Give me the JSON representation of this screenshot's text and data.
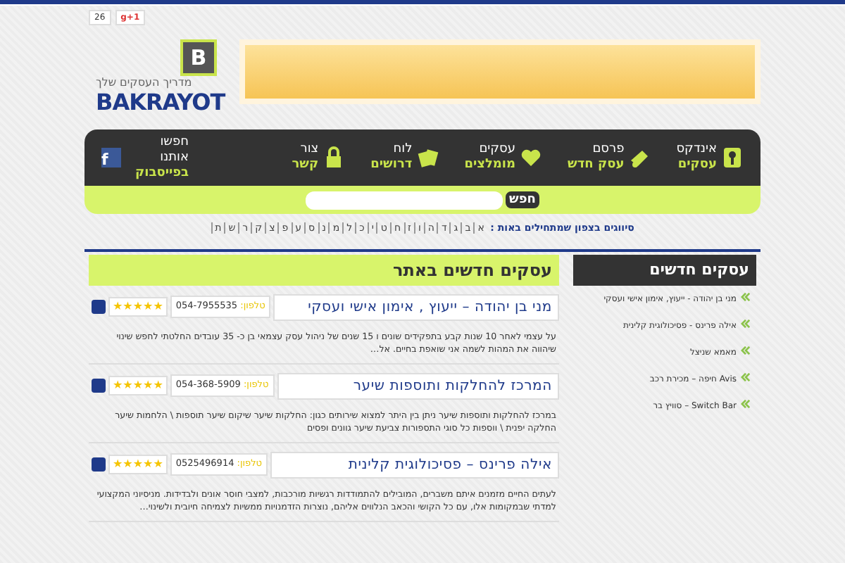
{
  "share": {
    "count": "26",
    "plus_one": "g+1"
  },
  "logo": {
    "tagline": "מדריך העסקים שלך",
    "name": "BAKRAYOT",
    "badge": "B"
  },
  "nav": [
    {
      "line1": "אינדקס",
      "line2": "עסקים"
    },
    {
      "line1": "פרסם",
      "line2": "עסק חדש"
    },
    {
      "line1": "עסקים",
      "line2": "מומלצים"
    },
    {
      "line1": "לוח",
      "line2": "דרושים"
    },
    {
      "line1": "צור",
      "line2": "קשר"
    }
  ],
  "facebook": {
    "line1": "חפשו",
    "line2": "אותנו",
    "line3": "בפייסבוק",
    "badge": "f"
  },
  "search": {
    "button": "חפש"
  },
  "letters": {
    "label": "סיווגים בצפון שמתחילים באות :",
    "items": [
      "א",
      "ב",
      "ג",
      "ד",
      "ה",
      "ו",
      "ז",
      "ח",
      "ט",
      "י",
      "כ",
      "ל",
      "מ",
      "נ",
      "ס",
      "ע",
      "פ",
      "צ",
      "ק",
      "ר",
      "ש",
      "ת"
    ]
  },
  "main": {
    "heading": "עסקים חדשים באתר",
    "items": [
      {
        "title": "מני בן יהודה – ייעוץ , אימון אישי ועסקי",
        "phone_label": "טלפון:",
        "phone": "054-7955535",
        "stars": 5,
        "text": "על עצמי לאחר 10 שנות קבע בתפקידים שונים ו 15 שנים של ניהול עסק עצמאי בן כ- 35 עובדים החלטתי לחפש שינוי שיהווה את המהות לשמה אני שואפת בחיים. אל…"
      },
      {
        "title": "המרכז להחלקות ותוספות שיער",
        "phone_label": "טלפון:",
        "phone": "054-368-5909",
        "stars": 5,
        "text": "במרכז להחלקות ותוספות שיער ניתן בין היתר למצוא שירותים כגון: החלקות שיער שיקום שיער תוספות \\ הלחמות שיער החלקה יפנית \\ ווספות כל סוגי התספורות צביעת שיער גוונים ופסים"
      },
      {
        "title": "אילה פרינס – פסיכולוגית קלינית",
        "phone_label": "טלפון:",
        "phone": "0525496914",
        "stars": 5,
        "text": "לעתים החיים מזמנים איתם משברים, המובילים להתמודדות רגשיות מורכבות, למצבי חוסר אונים ולבדידות. מניסיוני המקצועי למדתי שבמקומות אלו, עם כל הקושי והכאב הנלווים אליהם, נוצרות הזדמנויות ממשיות לצמיחה חיובית ולשינוי…"
      }
    ]
  },
  "sidebar": {
    "heading": "עסקים חדשים",
    "items": [
      "מני בן יהודה - ייעוץ, אימון אישי ועסקי",
      "אילה פרינס - פסיכולוגית קלינית",
      "מאמא שניצל",
      "Avis חיפה – מכירת רכב",
      "Switch Bar – סוויץ בר"
    ]
  }
}
